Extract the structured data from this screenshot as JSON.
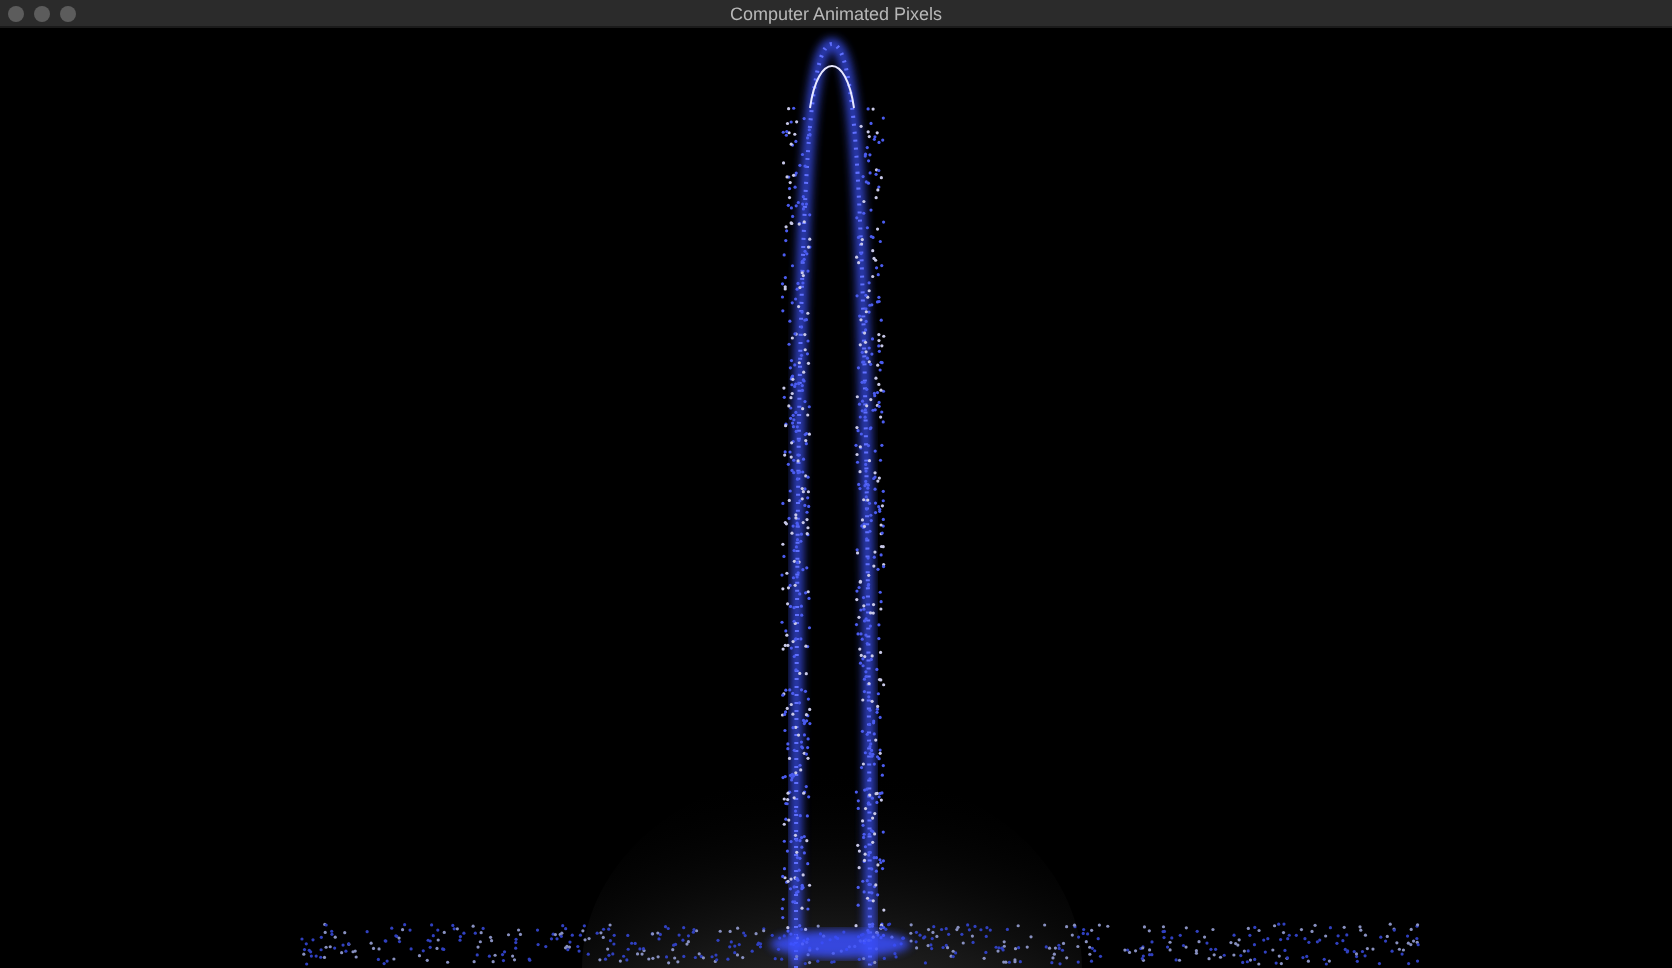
{
  "window": {
    "title": "Computer Animated Pixels"
  }
}
